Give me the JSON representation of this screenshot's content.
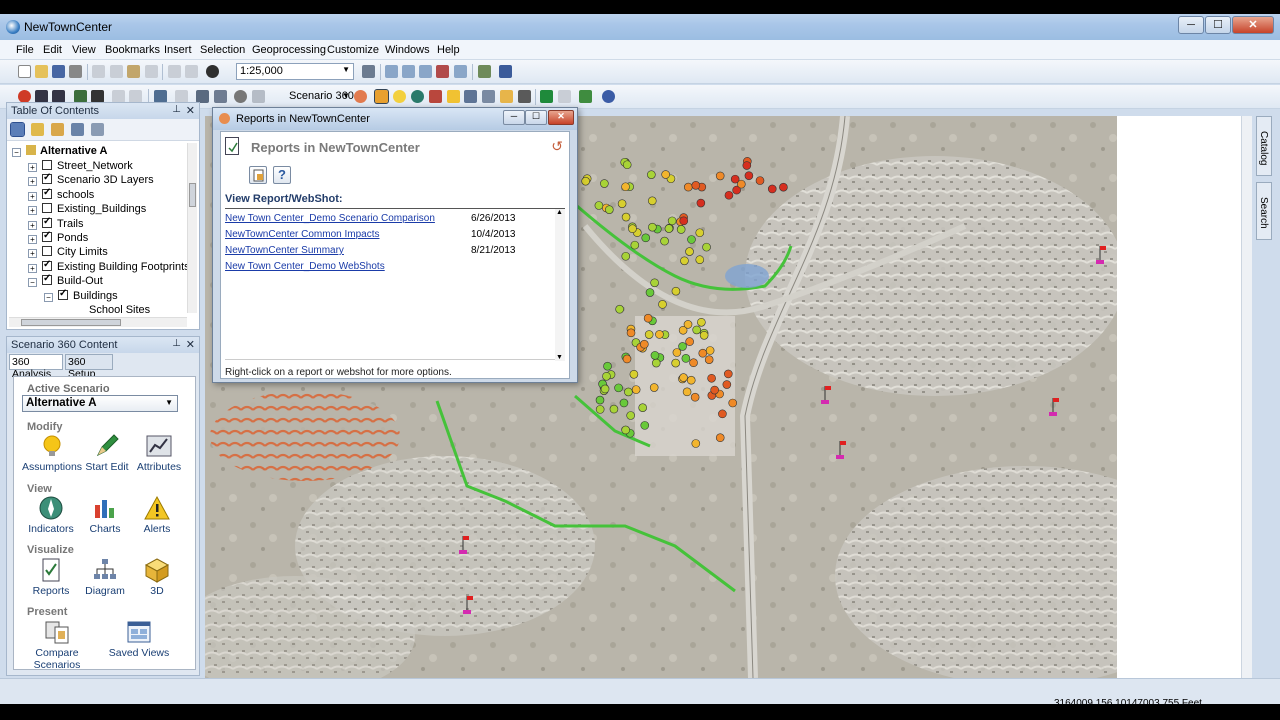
{
  "window": {
    "title": "NewTownCenter",
    "minimize": "─",
    "maximize": "☐",
    "close": "✕"
  },
  "menu": [
    "File",
    "Edit",
    "View",
    "Bookmarks",
    "Insert",
    "Selection",
    "Geoprocessing",
    "Customize",
    "Windows",
    "Help"
  ],
  "toolbar": {
    "scale": "1:25,000",
    "scenario_menu": "Scenario 360"
  },
  "toc": {
    "title": "Table Of Contents",
    "layers": [
      {
        "label": "Alternative A",
        "bold": true,
        "checkbox": false
      },
      {
        "label": "Street_Network",
        "checked": false
      },
      {
        "label": "Scenario 3D Layers",
        "checked": true
      },
      {
        "label": "schools",
        "checked": true
      },
      {
        "label": "Existing_Buildings",
        "checked": false
      },
      {
        "label": "Trails",
        "checked": true
      },
      {
        "label": "Ponds",
        "checked": true
      },
      {
        "label": "City Limits",
        "checked": false
      },
      {
        "label": "Existing Building Footprints",
        "checked": true
      },
      {
        "label": "Build-Out",
        "checked": true
      },
      {
        "label": "Buildings",
        "checked": true
      },
      {
        "label": "School Sites"
      }
    ]
  },
  "s360": {
    "title": "Scenario 360 Content",
    "tabs": [
      "360 Analysis",
      "360 Setup"
    ],
    "active_scenario_label": "Active Scenario",
    "active_scenario_value": "Alternative A",
    "groups": {
      "modify": "Modify",
      "view": "View",
      "visualize": "Visualize",
      "present": "Present"
    },
    "tools": {
      "assumptions": "Assumptions",
      "start_edit": "Start Edit",
      "attributes": "Attributes",
      "indicators": "Indicators",
      "charts": "Charts",
      "alerts": "Alerts",
      "reports": "Reports",
      "diagram": "Diagram",
      "three_d": "3D",
      "compare_1": "Compare",
      "compare_2": "Scenarios",
      "saved_views": "Saved Views"
    }
  },
  "dialog": {
    "title": "Reports in NewTownCenter",
    "heading": "Reports in NewTownCenter",
    "section": "View Report/WebShot:",
    "reports": [
      {
        "name": "New Town Center_Demo Scenario Comparison",
        "date": "6/26/2013"
      },
      {
        "name": "NewTownCenter Common Impacts",
        "date": "10/4/2013"
      },
      {
        "name": "NewTownCenter Summary",
        "date": "8/21/2013"
      },
      {
        "name": "New Town Center_Demo WebShots",
        "date": ""
      }
    ],
    "hint": "Right-click on a report or webshot for more options."
  },
  "side_tabs": [
    "Catalog",
    "Search"
  ],
  "status": {
    "coords": "3164009.156  10147003.755 Feet"
  }
}
